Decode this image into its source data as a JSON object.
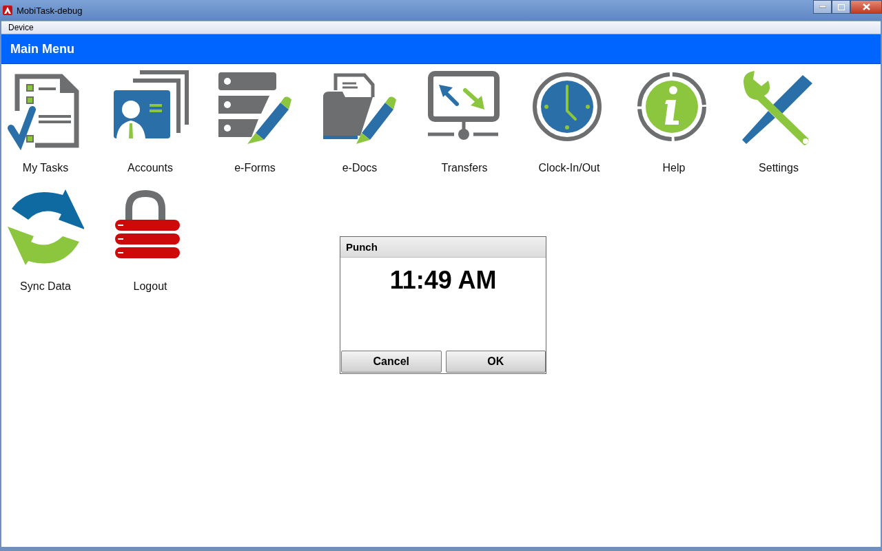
{
  "window": {
    "title": "MobiTask-debug"
  },
  "menu_bar": [
    "Device"
  ],
  "header": {
    "title": "Main Menu"
  },
  "tiles": [
    {
      "label": "My Tasks",
      "kind": "tasks"
    },
    {
      "label": "Accounts",
      "kind": "accounts"
    },
    {
      "label": "e-Forms",
      "kind": "forms"
    },
    {
      "label": "e-Docs",
      "kind": "docs"
    },
    {
      "label": "Transfers",
      "kind": "transfers"
    },
    {
      "label": "Clock-In/Out",
      "kind": "clock"
    },
    {
      "label": "Help",
      "kind": "help"
    },
    {
      "label": "Settings",
      "kind": "settings"
    },
    {
      "label": "Sync Data",
      "kind": "sync"
    },
    {
      "label": "Logout",
      "kind": "logout"
    }
  ],
  "dialog": {
    "title": "Punch",
    "time": "11:49 AM",
    "buttons": [
      "Cancel",
      "OK"
    ]
  }
}
